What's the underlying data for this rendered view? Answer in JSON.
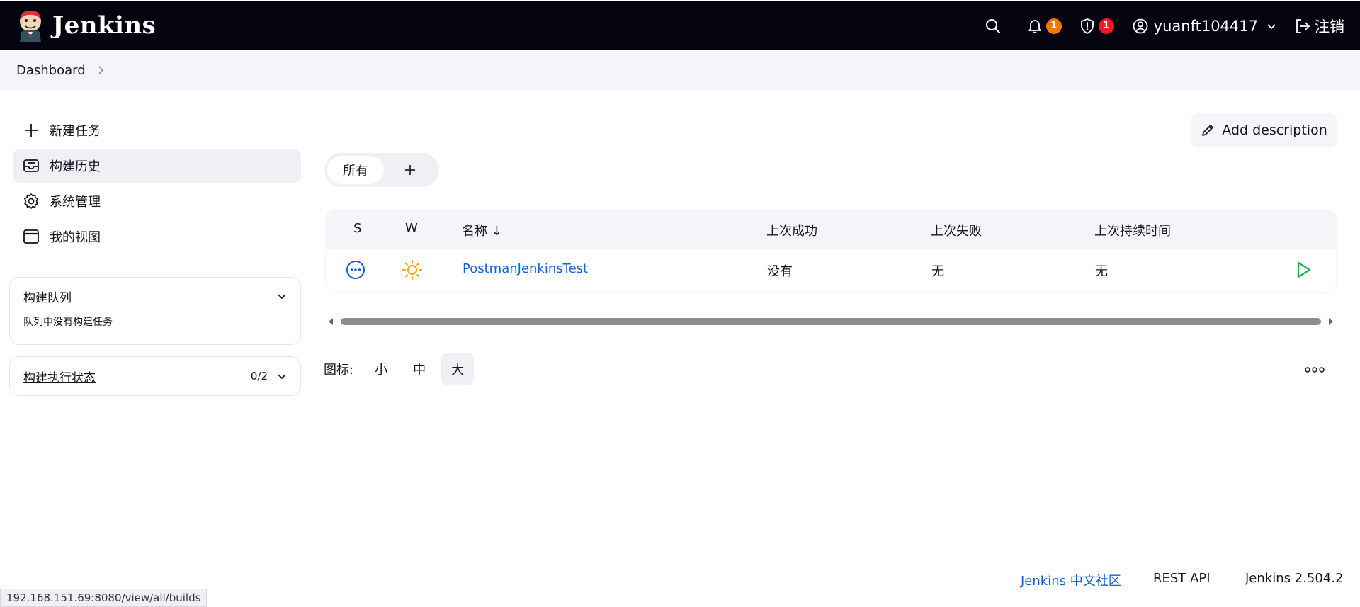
{
  "header": {
    "brand": "Jenkins",
    "notifications_count": "1",
    "security_count": "1",
    "username": "yuanft104417",
    "logout_label": "注销",
    "colors": {
      "bg": "#040411",
      "notify_badge": "#f07800",
      "security_badge": "#e81d1d"
    }
  },
  "breadcrumb": {
    "items": [
      "Dashboard"
    ]
  },
  "sidebar": {
    "tasks": [
      {
        "label": "新建任务",
        "icon": "plus-icon"
      },
      {
        "label": "构建历史",
        "icon": "inbox-icon",
        "active": true
      },
      {
        "label": "系统管理",
        "icon": "gear-icon"
      },
      {
        "label": "我的视图",
        "icon": "window-icon"
      }
    ],
    "build_queue": {
      "title": "构建队列",
      "empty_text": "队列中没有构建任务"
    },
    "executor_status": {
      "title": "构建执行状态",
      "count": "0/2"
    }
  },
  "main": {
    "add_description": "Add description",
    "tabs": [
      {
        "label": "所有",
        "active": true
      }
    ],
    "table": {
      "headers": [
        "S",
        "W",
        "名称 ↓",
        "上次成功",
        "上次失败",
        "上次持续时间"
      ],
      "rows": [
        {
          "status_icon": "pending-icon",
          "weather_icon": "sunny-icon",
          "name": "PostmanJenkinsTest",
          "last_success": "没有",
          "last_failure": "无",
          "last_duration": "无"
        }
      ]
    },
    "icon_size": {
      "label": "图标:",
      "options": [
        "小",
        "中",
        "大"
      ],
      "selected": "大"
    }
  },
  "footer": {
    "community": "Jenkins 中文社区",
    "rest_api": "REST API",
    "version": "Jenkins 2.504.2"
  },
  "status_bar_url": "192.168.151.69:8080/view/all/builds"
}
